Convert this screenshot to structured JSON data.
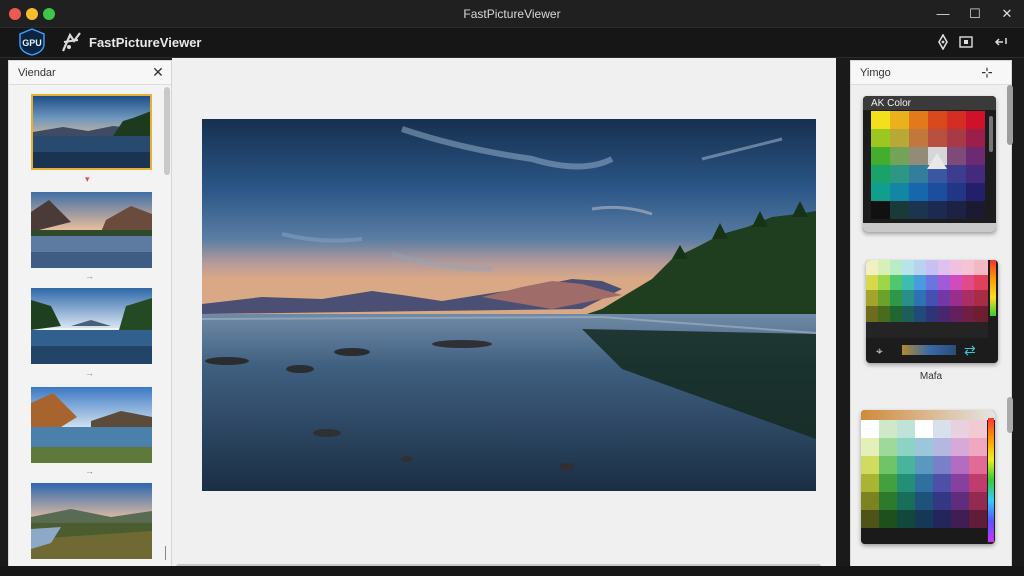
{
  "window": {
    "title": "FastPictureViewer"
  },
  "toolbar": {
    "app_name": "FastPictureViewer",
    "gpu_label": "GPU"
  },
  "left_panel": {
    "title": "Viendar",
    "close": "✕"
  },
  "right_panel": {
    "title": "Yimgo",
    "pin": "⊹",
    "card1_title": "AK Color",
    "card2_label": "Mafa"
  },
  "colors": {
    "accent": "#e2b237",
    "titlebar": "#202020",
    "panel_bg": "#f3f3f3"
  },
  "icons": [
    "gpu-icon",
    "app-logo-icon",
    "pen-icon",
    "frame-icon",
    "undo-icon",
    "close-icon",
    "minimize-icon",
    "maximize-icon"
  ]
}
